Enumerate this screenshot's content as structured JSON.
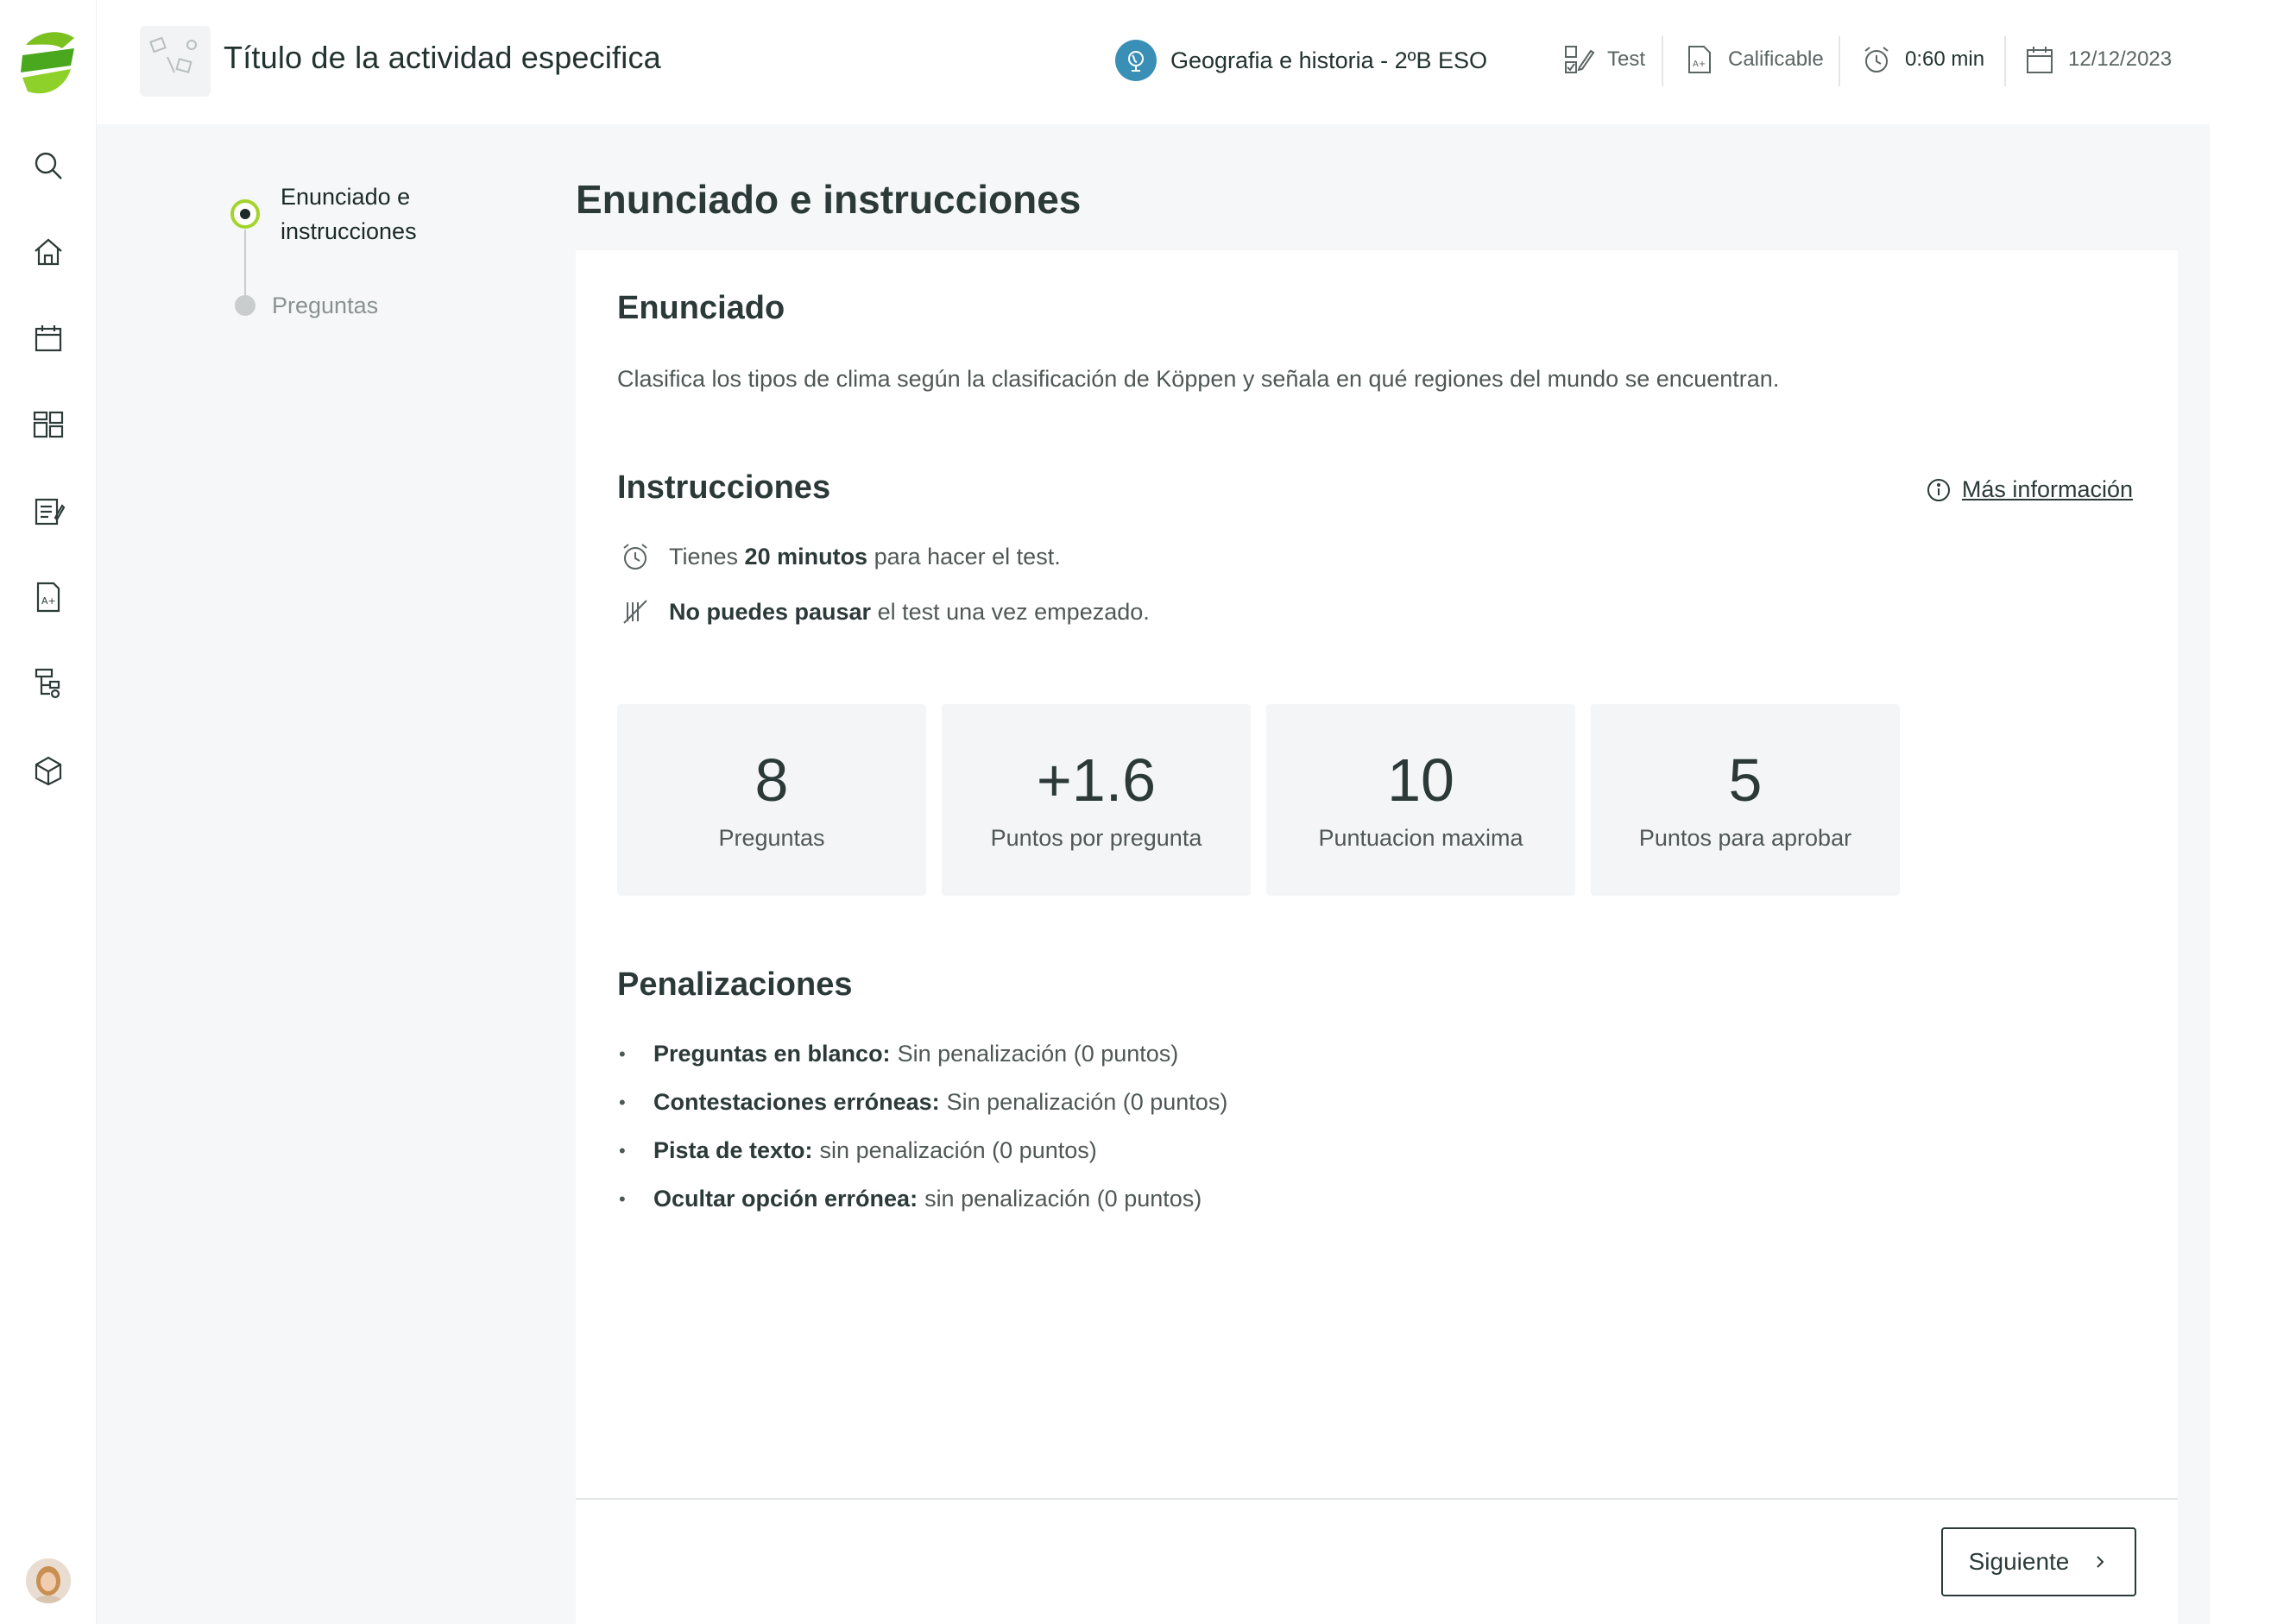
{
  "header": {
    "title": "Título de la actividad especifica",
    "subject": "Geografia e historia - 2ºB ESO",
    "type": "Test",
    "grading": "Calificable",
    "duration": "0:60 min",
    "date": "12/12/2023"
  },
  "sidebar": {
    "items": [
      {
        "icon": "search-icon"
      },
      {
        "icon": "home-icon"
      },
      {
        "icon": "calendar-icon"
      },
      {
        "icon": "dashboard-icon"
      },
      {
        "icon": "tasks-icon"
      },
      {
        "icon": "grades-icon"
      },
      {
        "icon": "tree-icon"
      },
      {
        "icon": "box-icon"
      }
    ]
  },
  "stepper": {
    "steps": [
      {
        "label": "Enunciado e instrucciones",
        "state": "active"
      },
      {
        "label": "Preguntas",
        "state": "pending"
      }
    ]
  },
  "page_title": "Enunciado e instrucciones",
  "statement": {
    "heading": "Enunciado",
    "text": "Clasifica los tipos de clima según la clasificación de Köppen y señala en qué regiones del mundo se encuentran."
  },
  "instructions": {
    "heading": "Instrucciones",
    "more_info": "Más información",
    "items": [
      {
        "prefix": "Tienes ",
        "bold": "20 minutos",
        "suffix": " para hacer el test."
      },
      {
        "prefix": "",
        "bold": "No puedes pausar",
        "suffix": " el test una vez empezado."
      }
    ]
  },
  "stats": [
    {
      "value": "8",
      "label": "Preguntas"
    },
    {
      "value": "+1.6",
      "label": "Puntos por pregunta"
    },
    {
      "value": "10",
      "label": "Puntuacion maxima"
    },
    {
      "value": "5",
      "label": "Puntos para aprobar"
    }
  ],
  "penalties": {
    "heading": "Penalizaciones",
    "items": [
      {
        "label": "Preguntas en blanco:",
        "value": "Sin penalización (0 puntos)"
      },
      {
        "label": "Contestaciones erróneas:",
        "value": "Sin penalización (0 puntos)"
      },
      {
        "label": "Pista de texto:",
        "value": "sin penalización (0 puntos)"
      },
      {
        "label": "Ocultar opción errónea:",
        "value": "sin penalización (0 puntos)"
      }
    ]
  },
  "footer": {
    "next_label": "Siguiente"
  },
  "colors": {
    "accent": "#a3d42c",
    "logo_green": "#7bc11f",
    "subject_blue": "#3a8fb7",
    "text": "#2b3a38"
  }
}
